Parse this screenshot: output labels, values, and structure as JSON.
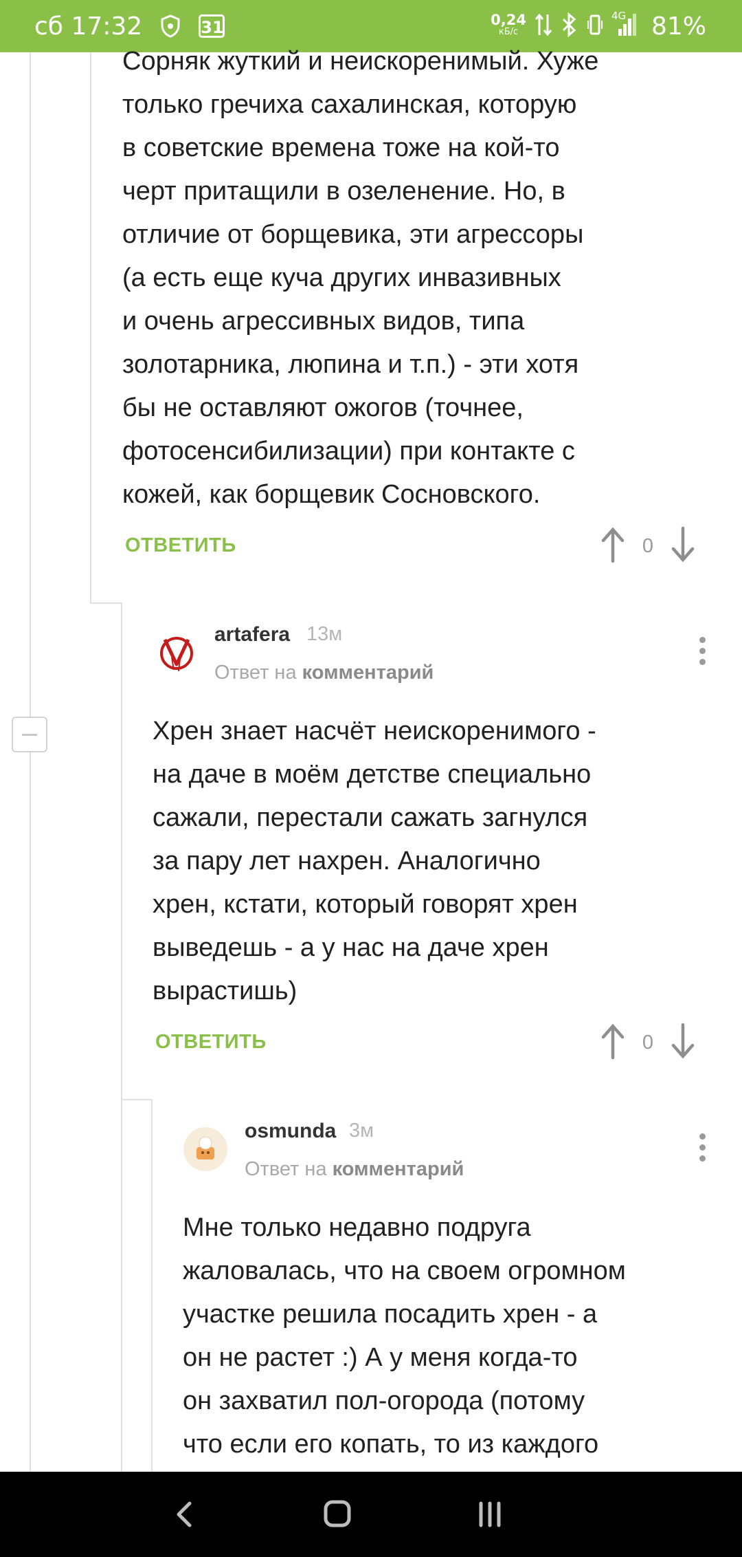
{
  "status_bar": {
    "time": "сб 17:32",
    "calendar_badge": "31",
    "net_speed_value": "0,24",
    "net_speed_unit": "кБ/с",
    "network_type": "4G",
    "battery": "81%"
  },
  "comments": [
    {
      "text": "Сорняк жуткий и неискоренимый. Хуже\nтолько гречиха сахалинская, которую\nв советские времена тоже на кой-то\nчерт притащили в озеленение. Но, в\nотличие от борщевика, эти агрессоры\n(а есть еще куча других инвазивных\nи очень агрессивных видов, типа\nзолотарника, люпина и т.п.) - эти хотя\nбы не оставляют ожогов (точнее,\nфотосенсибилизации) при контакте с\nкожей, как борщевик Сосновского.",
      "reply_label": "ОТВЕТИТЬ",
      "votes": "0"
    },
    {
      "author": "artafera",
      "time": "13м",
      "reply_prefix": "Ответ на",
      "reply_target": "комментарий",
      "text": "Хрен знает насчёт неискоренимого -\nна даче в моём детстве специально\nсажали, перестали сажать загнулся\nза пару лет нахрен. Аналогично\nхрен, кстати, который говорят хрен\nвыведешь - а у нас на даче хрен\nвырастишь)",
      "reply_label": "ОТВЕТИТЬ",
      "votes": "0"
    },
    {
      "author": "osmunda",
      "time": "3м",
      "reply_prefix": "Ответ на",
      "reply_target": "комментарий",
      "text": "Мне только недавно подруга\nжаловалась, что на своем огромном\nучастке решила посадить хрен - а\nон не растет :) А у меня когда-то\nон захватил пол-огорода (потому\nчто если его копать, то из каждого"
    }
  ],
  "colors": {
    "accent": "#8ac048",
    "status_bar": "#8ac048"
  }
}
